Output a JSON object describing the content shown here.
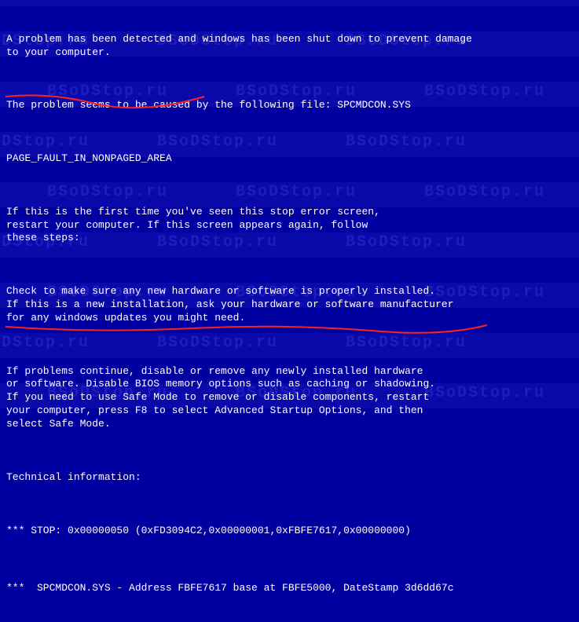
{
  "bsod": {
    "intro": "A problem has been detected and windows has been shut down to prevent damage\nto your computer.",
    "cause": "The problem seems to be caused by the following file: SPCMDCON.SYS",
    "errorName": "PAGE_FAULT_IN_NONPAGED_AREA",
    "firstTime": "If this is the first time you've seen this stop error screen,\nrestart your computer. If this screen appears again, follow\nthese steps:",
    "checkHardware": "Check to make sure any new hardware or software is properly installed.\nIf this is a new installation, ask your hardware or software manufacturer\nfor any windows updates you might need.",
    "problemsContinue": "If problems continue, disable or remove any newly installed hardware\nor software. Disable BIOS memory options such as caching or shadowing.\nIf you need to use Safe Mode to remove or disable components, restart\nyour computer, press F8 to select Advanced Startup Options, and then\nselect Safe Mode.",
    "techInfoHeader": "Technical information:",
    "stopLine": "*** STOP: 0x00000050 (0xFD3094C2,0x00000001,0xFBFE7617,0x00000000)",
    "moduleLine": "***  SPCMDCON.SYS - Address FBFE7617 base at FBFE5000, DateStamp 3d6dd67c"
  },
  "watermark": "BSoDStop.ru",
  "colors": {
    "background": "#0000a0",
    "text": "#ffffff",
    "highlight": "#ff3030"
  }
}
